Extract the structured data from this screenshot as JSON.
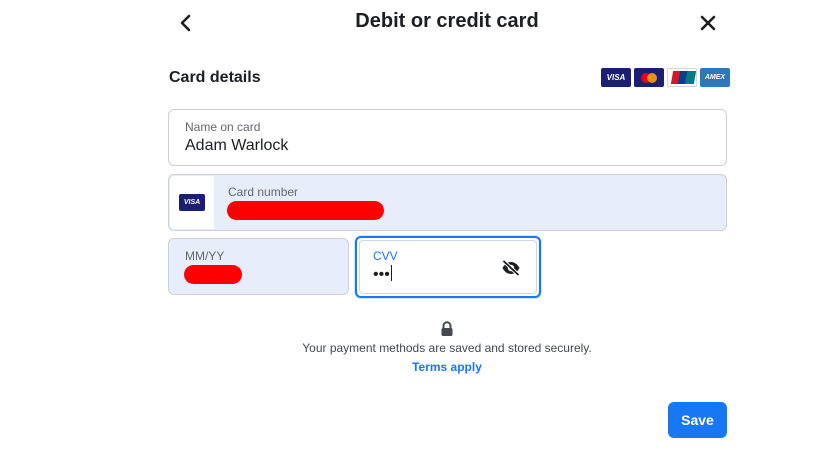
{
  "header": {
    "title": "Debit or credit card",
    "back_icon": "chevron-left-icon",
    "close_icon": "close-icon"
  },
  "card_details": {
    "title": "Card details",
    "accepted_cards": [
      {
        "name": "visa",
        "label": "VISA"
      },
      {
        "name": "mastercard",
        "label": ""
      },
      {
        "name": "unionpay",
        "label": ""
      },
      {
        "name": "amex",
        "label": "AMEX"
      }
    ]
  },
  "form": {
    "name": {
      "label": "Name on card",
      "value": "Adam Warlock"
    },
    "card_number": {
      "label": "Card number",
      "value": "",
      "brand": "VISA",
      "redacted": true
    },
    "expiry": {
      "label": "MM/YY",
      "value": "",
      "redacted": true
    },
    "cvv": {
      "label": "CVV",
      "value": "•••",
      "toggle_icon": "eye-off-icon"
    }
  },
  "security": {
    "icon": "lock-icon",
    "note": "Your payment methods are saved and stored securely.",
    "terms_link": "Terms apply"
  },
  "actions": {
    "save_label": "Save"
  },
  "colors": {
    "accent": "#1877f2",
    "autofill_bg": "#e7edfb",
    "redaction": "#ff0000",
    "visa_navy": "#1a1f71"
  }
}
